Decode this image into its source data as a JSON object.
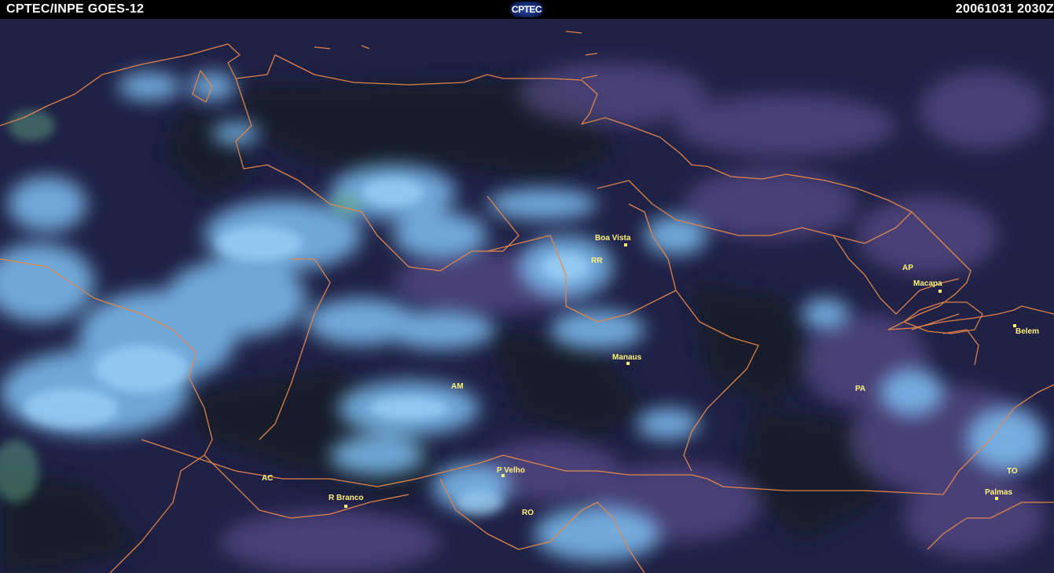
{
  "header": {
    "title": "CPTEC/INPE GOES-12",
    "logo": "CPTEC",
    "timestamp": "20061031 2030Z"
  },
  "colors": {
    "background": "#20234a",
    "cloud": "#7ec0f2",
    "border": "#e8874a",
    "label": "#fff27a"
  },
  "labels": {
    "boa_vista": "Boa Vista",
    "rr": "RR",
    "ap": "AP",
    "macapa": "Macapa",
    "belem": "Belem",
    "manaus": "Manaus",
    "am": "AM",
    "pa": "PA",
    "p_velho": "P Velho",
    "ac": "AC",
    "r_branco": "R Branco",
    "ro": "RO",
    "to": "TO",
    "palmas": "Palmas"
  }
}
